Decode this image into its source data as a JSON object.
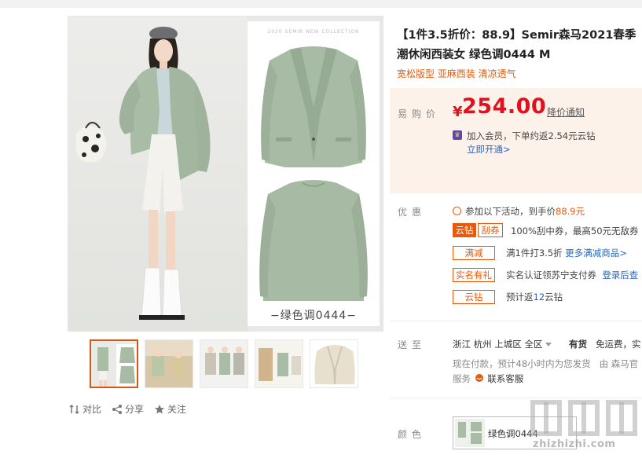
{
  "product": {
    "title_line1": "【1件3.5折价：88.9】Semir森马2021春季",
    "title_line2": "潮休闲西装女 绿色调0444 M",
    "subtitle": "宽松版型 亚麻西装 清凉透气"
  },
  "gallery": {
    "collection_text": "2020 SEMIR NEW COLLECTION",
    "color_caption": "−绿色调0444−",
    "thumb_count": 5,
    "active_thumb": 1
  },
  "actions": {
    "compare": "对比",
    "share": "分享",
    "follow": "关注"
  },
  "price": {
    "label": "易购价",
    "currency": "¥",
    "value": "254.00",
    "notify": "降价通知",
    "member_text": "加入会员，下单约返2.54元云钻",
    "member_link": "立即开通>"
  },
  "promo": {
    "label": "优惠",
    "activity_prefix": "参加以下活动，到手价",
    "activity_price": "88.9元",
    "items": [
      {
        "tags": [
          "云钻",
          "刮券"
        ],
        "text": "100%刮中券，最高50元无敌券"
      },
      {
        "tags": [
          "满减"
        ],
        "text": "满1件打3.5折",
        "link": "更多满减商品>"
      },
      {
        "tags": [
          "实名有礼"
        ],
        "text": "实名认证领苏宁支付券",
        "link": "登录后查"
      },
      {
        "tags": [
          "云钻"
        ],
        "text_prefix": "预计返",
        "text_num": "12",
        "text_suffix": "云钻"
      }
    ]
  },
  "shipping": {
    "label": "送至",
    "location": "浙江 杭州 上城区 全区",
    "stock": "有货",
    "free": "免运费，",
    "extra": "实",
    "note": "现在付款，预计48小时内为您发货",
    "by": "由 森马官",
    "service_label": "服务",
    "service_name": "联系客服"
  },
  "color": {
    "label": "颜色",
    "selected": "绿色调0444"
  },
  "watermark": {
    "url": "zhizhizhi.com"
  },
  "colors": {
    "price": "#e3101e",
    "accent": "#e8590c",
    "link": "#2566c2",
    "pricebox_bg": "#fdf2ea",
    "blazer": "#a9bca6"
  }
}
